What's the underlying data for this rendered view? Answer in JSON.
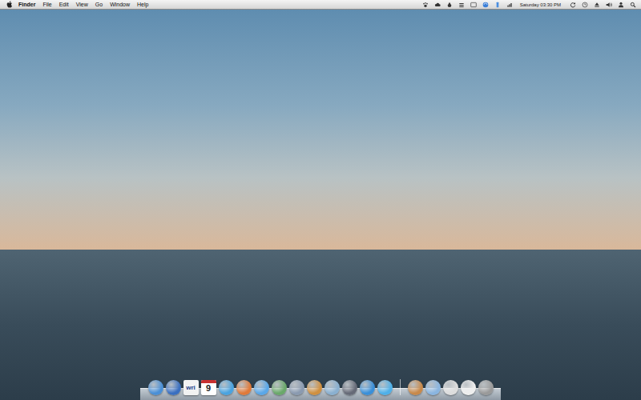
{
  "menu_bar": {
    "menus": [
      {
        "label": "Finder",
        "bold": true
      },
      {
        "label": "File",
        "bold": false
      },
      {
        "label": "Edit",
        "bold": false
      },
      {
        "label": "View",
        "bold": false
      },
      {
        "label": "Go",
        "bold": false
      },
      {
        "label": "Window",
        "bold": false
      },
      {
        "label": "Help",
        "bold": false
      }
    ],
    "clock": "Saturday 03:30 PM"
  },
  "dock": {
    "items": [
      {
        "kind": "app",
        "color": "#4a8fd6"
      },
      {
        "kind": "app",
        "color": "#3a6fc0"
      },
      {
        "kind": "document",
        "label": "wri",
        "color": "#f2f2f2"
      },
      {
        "kind": "calendar",
        "label": "9",
        "color": "#ffffff"
      },
      {
        "kind": "app",
        "color": "#4aa3e0"
      },
      {
        "kind": "app",
        "color": "#e07a3a"
      },
      {
        "kind": "app",
        "color": "#5aa7e8"
      },
      {
        "kind": "app",
        "color": "#6aa86a"
      },
      {
        "kind": "app",
        "color": "#8a9ab0"
      },
      {
        "kind": "app",
        "color": "#d09040"
      },
      {
        "kind": "app",
        "color": "#8ab0d0"
      },
      {
        "kind": "app",
        "color": "#666a77"
      },
      {
        "kind": "app",
        "color": "#3a8fd8"
      },
      {
        "kind": "app",
        "color": "#4fb0e8"
      },
      {
        "kind": "separator"
      },
      {
        "kind": "app",
        "color": "#c8894a"
      },
      {
        "kind": "app",
        "color": "#8ab5e0"
      },
      {
        "kind": "app",
        "color": "#dddddd"
      },
      {
        "kind": "app",
        "color": "#eeeeee"
      },
      {
        "kind": "app",
        "color": "#9a9a9a"
      }
    ]
  }
}
